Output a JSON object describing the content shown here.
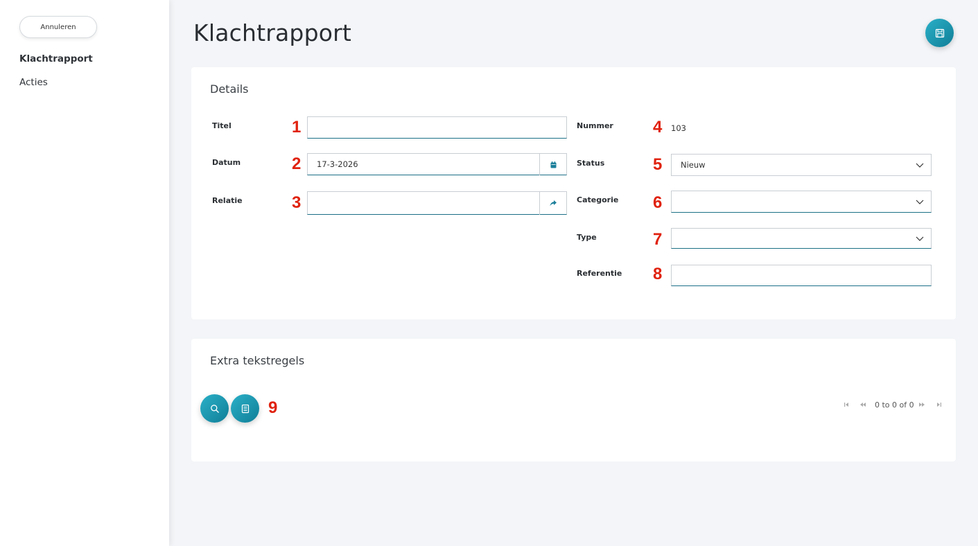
{
  "sidebar": {
    "cancel_label": "Annuleren",
    "nav": [
      {
        "label": "Klachtrapport",
        "active": true
      },
      {
        "label": "Acties",
        "active": false
      }
    ]
  },
  "header": {
    "title": "Klachtrapport",
    "save_icon": "save-icon"
  },
  "details": {
    "title": "Details",
    "fields": {
      "titel": {
        "label": "Titel",
        "value": "",
        "marker": "1"
      },
      "datum": {
        "label": "Datum",
        "value": "17-3-2026",
        "marker": "2",
        "icon": "calendar-icon"
      },
      "relatie": {
        "label": "Relatie",
        "value": "",
        "marker": "3",
        "icon": "share-arrow-icon"
      },
      "nummer": {
        "label": "Nummer",
        "value": "103",
        "marker": "4"
      },
      "status": {
        "label": "Status",
        "value": "Nieuw",
        "marker": "5"
      },
      "categorie": {
        "label": "Categorie",
        "value": "",
        "marker": "6"
      },
      "type": {
        "label": "Type",
        "value": "",
        "marker": "7"
      },
      "referentie": {
        "label": "Referentie",
        "value": "",
        "marker": "8"
      }
    }
  },
  "extra": {
    "title": "Extra tekstregels",
    "marker": "9",
    "buttons": [
      "search-icon",
      "document-icon"
    ],
    "pager_text": "0 to 0 of 0"
  },
  "colors": {
    "accent": "#1b8fa8",
    "marker": "#e0220f",
    "field_underline": "#1b6f86"
  }
}
